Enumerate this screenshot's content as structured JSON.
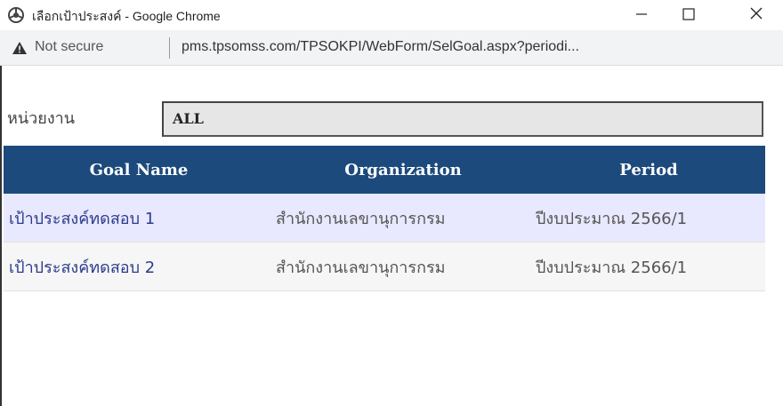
{
  "window": {
    "title": "เลือกเป้าประสงค์ - Google Chrome",
    "icon": "chrome-info-icon"
  },
  "addressbar": {
    "security_label": "Not secure",
    "url": "pms.tpsomss.com/TPSOKPI/WebForm/SelGoal.aspx?periodi..."
  },
  "filter": {
    "unit_label": "หน่วยงาน",
    "unit_value": "ALL"
  },
  "grid": {
    "columns": [
      "Goal Name",
      "Organization",
      "Period"
    ],
    "rows": [
      [
        "เป้าประสงค์ทดสอบ 1",
        "สำนักงานเลขานุการกรม",
        "ปีงบประมาณ 2566/1"
      ],
      [
        "เป้าประสงค์ทดสอบ 2",
        "สำนักงานเลขานุการกรม",
        "ปีงบประมาณ 2566/1"
      ]
    ]
  },
  "colors": {
    "header_bg": "#1c4a7d",
    "row_odd_bg": "#e8e8ff",
    "row_even_bg": "#f6f6f6",
    "link_text": "#2c3c8c"
  }
}
